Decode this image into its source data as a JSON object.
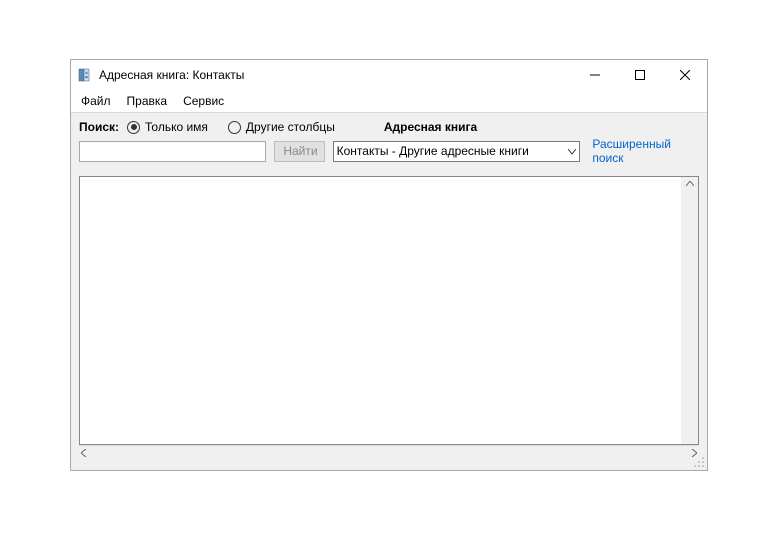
{
  "titlebar": {
    "title": "Адресная книга: Контакты"
  },
  "menubar": {
    "file": "Файл",
    "edit": "Правка",
    "tools": "Сервис"
  },
  "toolbar": {
    "search_label": "Поиск:",
    "radio_name_only": "Только имя",
    "radio_other_cols": "Другие столбцы",
    "address_book_label": "Адресная книга",
    "search_value": "",
    "find_button": "Найти",
    "book_selected": "Контакты - Другие адресные книги",
    "advanced_link": "Расширенный поиск"
  }
}
